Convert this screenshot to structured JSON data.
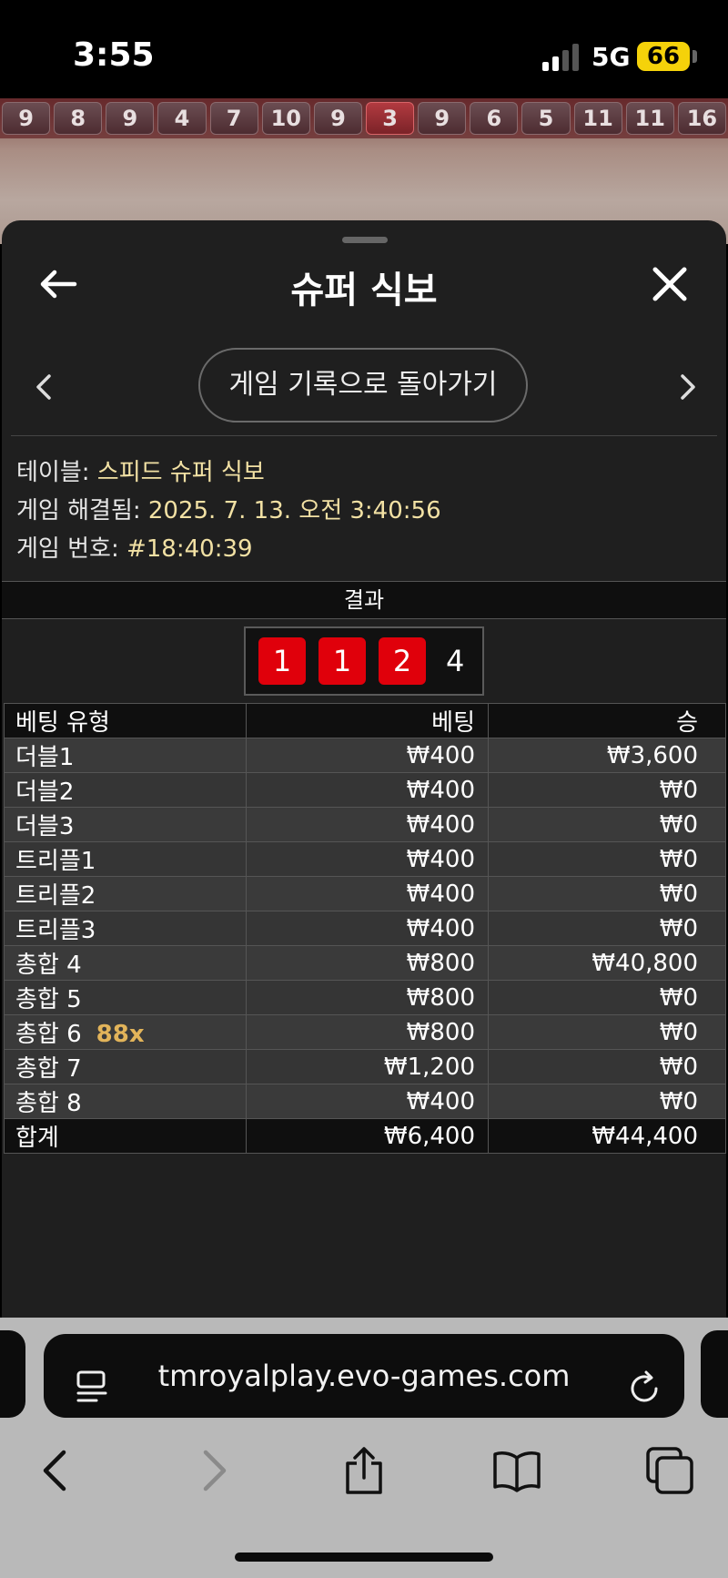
{
  "status": {
    "time": "3:55",
    "network": "5G",
    "battery": "66"
  },
  "road": {
    "cells": [
      "9",
      "8",
      "9",
      "4",
      "7",
      "10",
      "9",
      "3",
      "9",
      "6",
      "5",
      "11",
      "11",
      "16"
    ],
    "hot_index": 7
  },
  "panel": {
    "title": "슈퍼 식보",
    "back_to_history": "게임 기록으로 돌아가기",
    "table_label": "테이블:",
    "table_value": "스피드 슈퍼 식보",
    "resolved_label": "게임 해결됨:",
    "resolved_value": "2025. 7. 13. 오전 3:40:56",
    "game_no_label": "게임 번호:",
    "game_no_value": "#18:40:39"
  },
  "result": {
    "header": "결과",
    "dice": [
      "1",
      "1",
      "2"
    ],
    "total": "4"
  },
  "bets": {
    "headers": [
      "베팅 유형",
      "베팅",
      "승"
    ],
    "rows": [
      {
        "type": "더블1",
        "bet": "₩400",
        "win": "₩3,600",
        "mult": ""
      },
      {
        "type": "더블2",
        "bet": "₩400",
        "win": "₩0",
        "mult": ""
      },
      {
        "type": "더블3",
        "bet": "₩400",
        "win": "₩0",
        "mult": ""
      },
      {
        "type": "트리플1",
        "bet": "₩400",
        "win": "₩0",
        "mult": ""
      },
      {
        "type": "트리플2",
        "bet": "₩400",
        "win": "₩0",
        "mult": ""
      },
      {
        "type": "트리플3",
        "bet": "₩400",
        "win": "₩0",
        "mult": ""
      },
      {
        "type": "총합 4",
        "bet": "₩800",
        "win": "₩40,800",
        "mult": ""
      },
      {
        "type": "총합 5",
        "bet": "₩800",
        "win": "₩0",
        "mult": ""
      },
      {
        "type": "총합 6",
        "bet": "₩800",
        "win": "₩0",
        "mult": "88x"
      },
      {
        "type": "총합 7",
        "bet": "₩1,200",
        "win": "₩0",
        "mult": ""
      },
      {
        "type": "총합 8",
        "bet": "₩400",
        "win": "₩0",
        "mult": ""
      }
    ],
    "sum": {
      "type": "합계",
      "bet": "₩6,400",
      "win": "₩44,400"
    }
  },
  "browser": {
    "url": "tmroyalplay.evo-games.com"
  },
  "colors": {
    "accent_text": "#f2e1a4",
    "die_red": "#e0000b",
    "multiplier": "#e2b45a",
    "battery": "#f5d20a"
  }
}
